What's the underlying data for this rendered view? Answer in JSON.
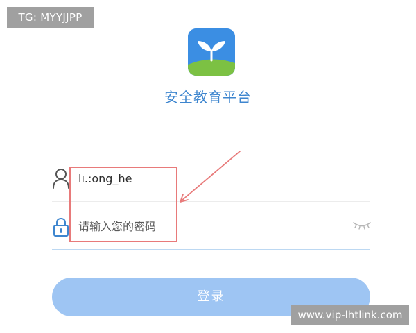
{
  "watermark_top": "TG: MYYJJPP",
  "watermark_bottom": "www.vip-lhtlink.com",
  "app": {
    "logo_icon": "sprout-logo-icon",
    "title": "安全教育平台"
  },
  "login_form": {
    "username": {
      "icon": "user-icon",
      "value": "lı.:ong_he"
    },
    "password": {
      "icon": "lock-icon",
      "placeholder": "请输入您的密码",
      "toggle_icon": "eye-closed-icon"
    },
    "submit_label": "登录"
  },
  "colors": {
    "accent": "#3e86cf",
    "button": "#9ec5f3",
    "annotation": "#e87a7a",
    "logo_blue": "#3b8ee3",
    "logo_green": "#7cc143"
  }
}
